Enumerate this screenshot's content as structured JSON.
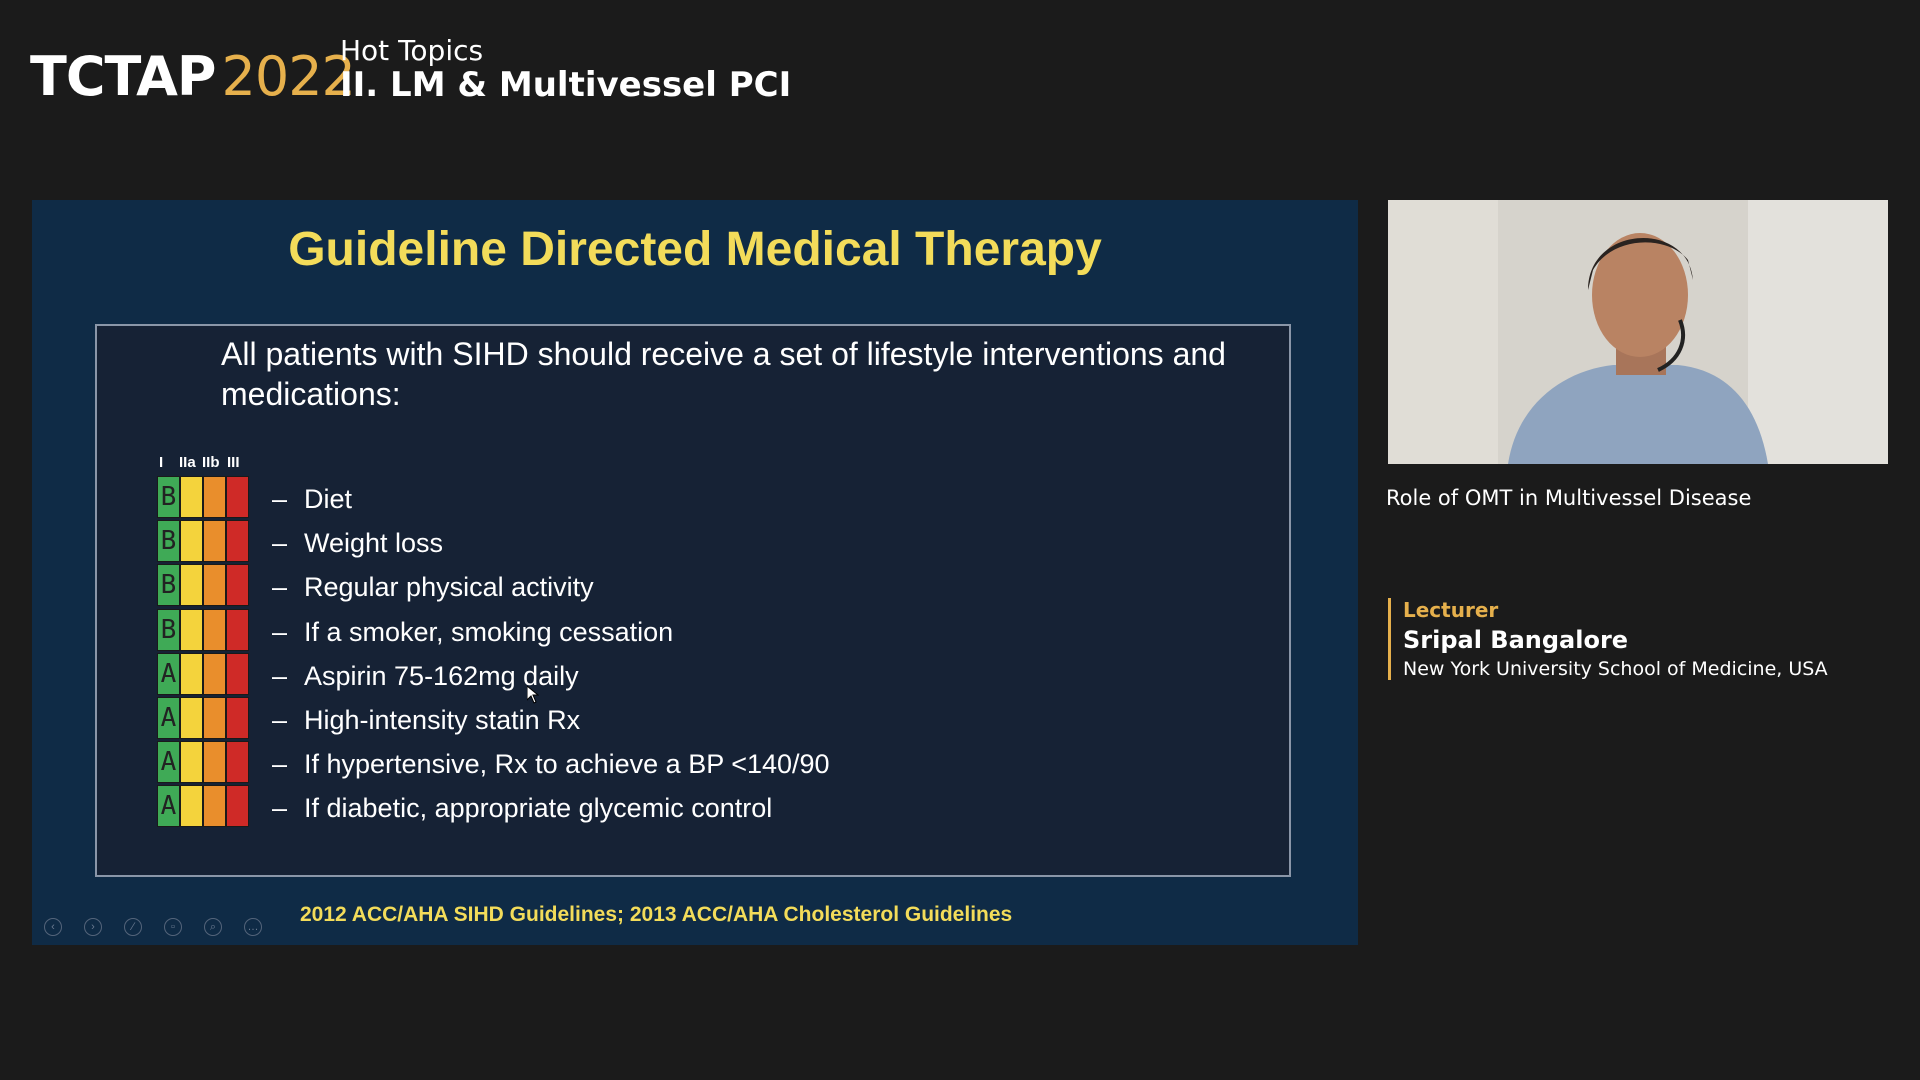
{
  "header": {
    "brand_name": "TCTAP",
    "brand_year": "2022",
    "session_sub": "Hot Topics",
    "session_main": "II. LM & Multivessel PCI"
  },
  "slide": {
    "title": "Guideline Directed Medical Therapy",
    "intro": "All patients with SIHD should receive a set of lifestyle interventions and medications:",
    "class_headers": [
      "I",
      "IIa",
      "IIb",
      "III"
    ],
    "items": [
      {
        "level": "B",
        "text": "Diet"
      },
      {
        "level": "B",
        "text": "Weight loss"
      },
      {
        "level": "B",
        "text": "Regular physical activity"
      },
      {
        "level": "B",
        "text": "If a smoker, smoking cessation"
      },
      {
        "level": "A",
        "text": "Aspirin 75-162mg daily"
      },
      {
        "level": "A",
        "text": "High-intensity statin Rx"
      },
      {
        "level": "A",
        "text": "If hypertensive, Rx to achieve a BP <140/90"
      },
      {
        "level": "A",
        "text": "If diabetic, appropriate glycemic control"
      }
    ],
    "dash": "–",
    "citation": "2012 ACC/AHA SIHD Guidelines; 2013 ACC/AHA Cholesterol Guidelines",
    "controls": [
      "prev-icon",
      "next-icon",
      "pen-icon",
      "slides-icon",
      "zoom-icon",
      "more-icon"
    ],
    "control_glyphs": [
      "‹",
      "›",
      "∕",
      "▫",
      "⌕",
      "…"
    ]
  },
  "talk": {
    "title": "Role of OMT in Multivessel Disease"
  },
  "lecturer": {
    "role": "Lecturer",
    "name": "Sripal Bangalore",
    "org": "New York University School of Medicine, USA"
  },
  "colors": {
    "accent_gold": "#e6b04c",
    "slide_title_yellow": "#f3dc5a",
    "slide_bg": "#0f2b46",
    "class_I": "#3faa56",
    "class_IIa": "#f4d33c",
    "class_IIb": "#e98e2c",
    "class_III": "#cf2a27"
  }
}
